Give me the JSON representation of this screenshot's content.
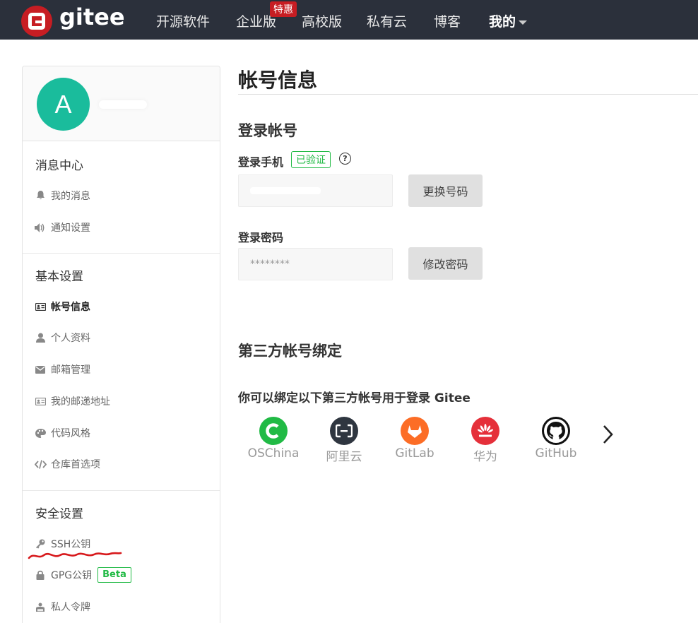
{
  "navbar": {
    "logo_text": "gitee",
    "items": [
      "开源软件",
      "企业版",
      "高校版",
      "私有云",
      "博客"
    ],
    "me_label": "我的",
    "promo_badge": "特惠"
  },
  "sidebar": {
    "avatar_letter": "A",
    "groups": [
      {
        "title": "消息中心",
        "items": [
          {
            "label": "我的消息",
            "icon": "bell-icon"
          },
          {
            "label": "通知设置",
            "icon": "speaker-icon"
          }
        ]
      },
      {
        "title": "基本设置",
        "items": [
          {
            "label": "帐号信息",
            "icon": "id-card-icon",
            "active": true
          },
          {
            "label": "个人资料",
            "icon": "user-icon"
          },
          {
            "label": "邮箱管理",
            "icon": "envelope-icon"
          },
          {
            "label": "我的邮递地址",
            "icon": "address-card-icon"
          },
          {
            "label": "代码风格",
            "icon": "palette-icon"
          },
          {
            "label": "仓库首选项",
            "icon": "code-icon"
          }
        ]
      },
      {
        "title": "安全设置",
        "items": [
          {
            "label": "SSH公钥",
            "icon": "key-icon"
          },
          {
            "label": "GPG公钥",
            "icon": "lock-icon",
            "badge": "Beta"
          },
          {
            "label": "私人令牌",
            "icon": "token-icon"
          }
        ]
      }
    ]
  },
  "main": {
    "page_title": "帐号信息",
    "login_section_title": "登录帐号",
    "phone_label": "登录手机",
    "verified_badge": "已验证",
    "help_icon": "?",
    "change_phone_button": "更换号码",
    "password_label": "登录密码",
    "password_value": "********",
    "change_password_button": "修改密码",
    "bind_section_title": "第三方帐号绑定",
    "bind_subtitle": "你可以绑定以下第三方帐号用于登录 Gitee",
    "providers": [
      {
        "label": "OSChina",
        "color": "#21ba45"
      },
      {
        "label": "阿里云",
        "color": "#2f3640"
      },
      {
        "label": "GitLab",
        "color": "#fc6d26"
      },
      {
        "label": "华为",
        "color": "#e5303a"
      },
      {
        "label": "GitHub",
        "color": "#111111"
      }
    ]
  }
}
